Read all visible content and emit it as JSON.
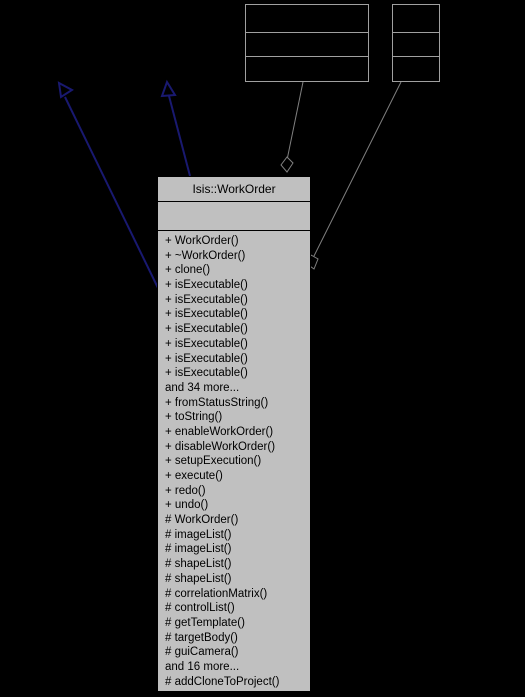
{
  "diagram": {
    "kind": "uml-collaboration-diagram",
    "background_color": "#000000",
    "node_fill_color": "#c0c0c0",
    "inheritance_edge_color": "#191970",
    "association_edge_color": "#808080",
    "stub_border_color": "#a0a0a0"
  },
  "main_class": {
    "name": "Isis::WorkOrder",
    "attributes": [],
    "methods": [
      {
        "visibility": "+",
        "label": "+ WorkOrder()"
      },
      {
        "visibility": "+",
        "label": "+ ~WorkOrder()"
      },
      {
        "visibility": "+",
        "label": "+ clone()"
      },
      {
        "visibility": "+",
        "label": "+ isExecutable()"
      },
      {
        "visibility": "+",
        "label": "+ isExecutable()"
      },
      {
        "visibility": "+",
        "label": "+ isExecutable()"
      },
      {
        "visibility": "+",
        "label": "+ isExecutable()"
      },
      {
        "visibility": "+",
        "label": "+ isExecutable()"
      },
      {
        "visibility": "+",
        "label": "+ isExecutable()"
      },
      {
        "visibility": "+",
        "label": "+ isExecutable()"
      },
      {
        "visibility": "",
        "label": "and 34 more..."
      },
      {
        "visibility": "+",
        "label": "+ fromStatusString()"
      },
      {
        "visibility": "+",
        "label": "+ toString()"
      },
      {
        "visibility": "+",
        "label": "+ enableWorkOrder()"
      },
      {
        "visibility": "+",
        "label": "+ disableWorkOrder()"
      },
      {
        "visibility": "+",
        "label": "+ setupExecution()"
      },
      {
        "visibility": "+",
        "label": "+ execute()"
      },
      {
        "visibility": "+",
        "label": "+ redo()"
      },
      {
        "visibility": "+",
        "label": "+ undo()"
      },
      {
        "visibility": "#",
        "label": "# WorkOrder()"
      },
      {
        "visibility": "#",
        "label": "# imageList()"
      },
      {
        "visibility": "#",
        "label": "# imageList()"
      },
      {
        "visibility": "#",
        "label": "# shapeList()"
      },
      {
        "visibility": "#",
        "label": "# shapeList()"
      },
      {
        "visibility": "#",
        "label": "# correlationMatrix()"
      },
      {
        "visibility": "#",
        "label": "# controlList()"
      },
      {
        "visibility": "#",
        "label": "# getTemplate()"
      },
      {
        "visibility": "#",
        "label": "# targetBody()"
      },
      {
        "visibility": "#",
        "label": "# guiCamera()"
      },
      {
        "visibility": "",
        "label": "and 16 more..."
      },
      {
        "visibility": "#",
        "label": "# addCloneToProject()"
      }
    ]
  },
  "stub_nodes": [
    {
      "id": "stub-wide",
      "name": "",
      "compartments": [
        "",
        "",
        ""
      ]
    },
    {
      "id": "stub-narrow",
      "name": "",
      "compartments": [
        "",
        "",
        ""
      ]
    }
  ],
  "edges": [
    {
      "id": "inheritance-left",
      "type": "inheritance",
      "arrowhead": "hollow-triangle",
      "color": "#191970"
    },
    {
      "id": "inheritance-right",
      "type": "inheritance",
      "arrowhead": "hollow-triangle",
      "color": "#191970"
    },
    {
      "id": "aggregation-top",
      "type": "aggregation",
      "arrowhead": "hollow-diamond",
      "color": "#808080"
    },
    {
      "id": "aggregation-right",
      "type": "aggregation",
      "arrowhead": "hollow-diamond",
      "color": "#808080"
    }
  ]
}
